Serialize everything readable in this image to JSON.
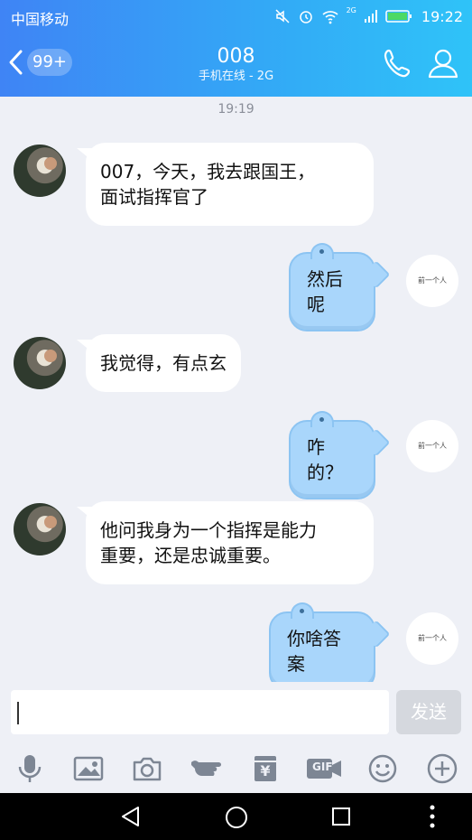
{
  "status_bar": {
    "carrier": "中国移动",
    "network_label": "2G",
    "time": "19:22"
  },
  "header": {
    "unread_badge": "99+",
    "contact_name": "008",
    "contact_status": "手机在线 - 2G"
  },
  "chat": {
    "timestamp": "19:19",
    "messages": [
      {
        "side": "left",
        "text_lines": [
          "007，今天，我去跟国王，",
          "面试指挥官了"
        ]
      },
      {
        "side": "right",
        "text": "然后呢"
      },
      {
        "side": "left",
        "text_lines": [
          "我觉得，有点玄"
        ]
      },
      {
        "side": "right",
        "text": "咋的？"
      },
      {
        "side": "left",
        "text_lines": [
          "他问我身为一个指挥是能力",
          "重要，还是忠诚重要。"
        ]
      },
      {
        "side": "right",
        "text": "你啥答案"
      }
    ],
    "my_avatar_text": "前一个人"
  },
  "composer": {
    "input_value": "",
    "send_label": "发送"
  },
  "toolbar": {
    "items": [
      "mic-icon",
      "image-icon",
      "camera-icon",
      "poke-icon",
      "red-packet-icon",
      "gif-icon",
      "emoji-icon",
      "plus-icon"
    ],
    "gif_label": "GIF",
    "yen_label": "¥"
  },
  "colors": {
    "header_start": "#3f84f5",
    "header_end": "#2fc3f8",
    "chat_bg": "#eef0f6",
    "my_bubble": "#a9d6fb",
    "their_bubble": "#ffffff"
  }
}
